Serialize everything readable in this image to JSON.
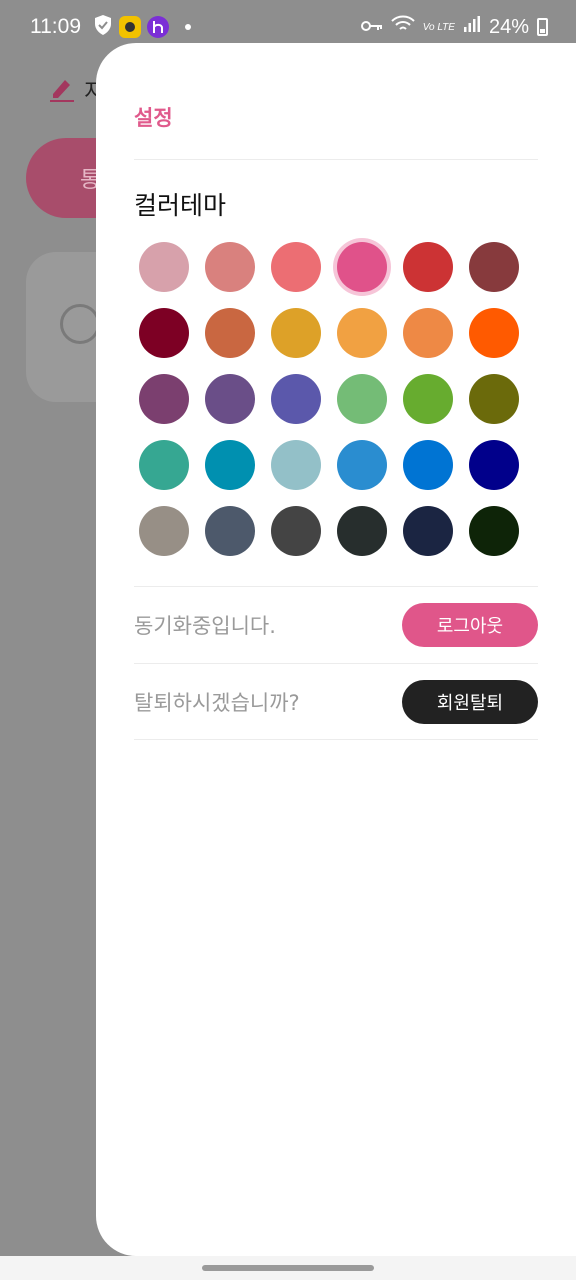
{
  "status": {
    "time": "11:09",
    "network": "Vo LTE",
    "battery": "24%"
  },
  "background": {
    "title": "지",
    "pill": "통"
  },
  "drawer": {
    "title": "설정",
    "section_title": "컬러테마",
    "swatches": [
      [
        "#d7a1ab",
        "#d9817e",
        "#ec6e73",
        "#e0528a",
        "#cc3334",
        "#873a3d"
      ],
      [
        "#7d0024",
        "#c96741",
        "#dda128",
        "#f1a142",
        "#ee8945",
        "#ff5a00"
      ],
      [
        "#7b3f6f",
        "#6a4e88",
        "#5b58ab",
        "#74bc76",
        "#67ac2f",
        "#6b6a0b"
      ],
      [
        "#36a792",
        "#0090b0",
        "#93c0c8",
        "#2a8dd0",
        "#0074d3",
        "#01008b"
      ],
      [
        "#978f86",
        "#4d596b",
        "#444444",
        "#272e2d",
        "#1b2542",
        "#0e2408"
      ]
    ],
    "selected": "#e0528a",
    "sync_text": "동기화중입니다.",
    "logout_label": "로그아웃",
    "withdraw_text": "탈퇴하시겠습니까?",
    "withdraw_label": "회원탈퇴"
  }
}
